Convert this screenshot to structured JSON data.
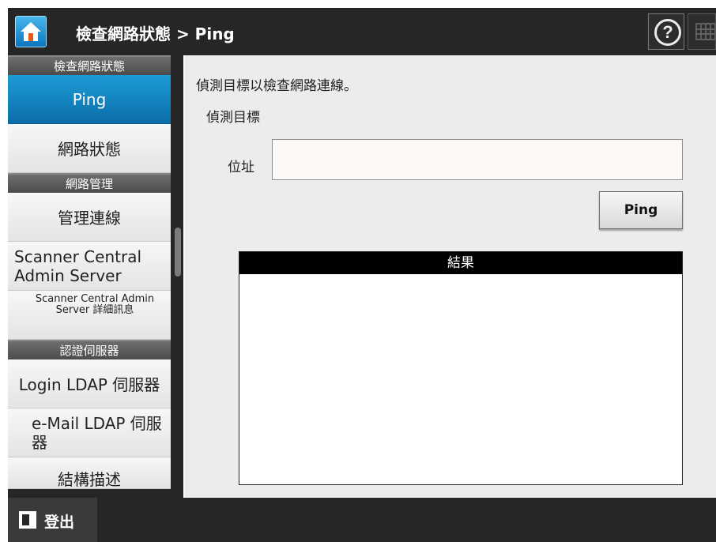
{
  "header": {
    "title": "檢查網路狀態 > Ping",
    "help_glyph": "?"
  },
  "sidebar": {
    "groups": [
      {
        "heading": "檢查網路狀態",
        "items": [
          {
            "label": "Ping",
            "active": true
          },
          {
            "label": "網路狀態"
          }
        ]
      },
      {
        "heading": "網路管理",
        "items": [
          {
            "label": "管理連線"
          },
          {
            "label": "Scanner Central Admin Server"
          },
          {
            "label": "Scanner Central Admin Server 詳細訊息"
          }
        ]
      },
      {
        "heading": "認證伺服器",
        "items": [
          {
            "label": "Login LDAP 伺服器"
          },
          {
            "label": "e-Mail LDAP 伺服器"
          },
          {
            "label": "結構描述"
          }
        ]
      }
    ]
  },
  "main": {
    "description": "偵測目標以檢查網路連線。",
    "section_label": "偵測目標",
    "address_label": "位址",
    "address_value": "",
    "ping_button": "Ping",
    "result_header": "結果",
    "result_text": ""
  },
  "footer": {
    "logout_label": "登出"
  },
  "colors": {
    "accent_active": "#0b6ea9",
    "chrome_dark": "#262626",
    "content_bg": "#ececec"
  }
}
